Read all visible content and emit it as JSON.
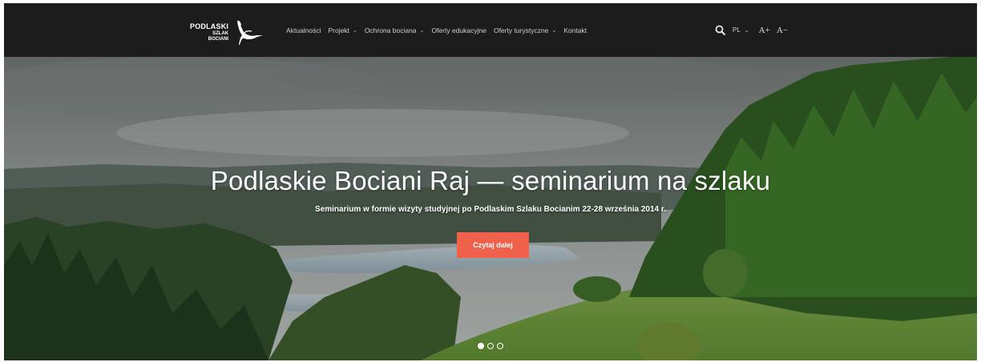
{
  "logo": {
    "line1": "PODLASKI",
    "line2": "SZLAK",
    "line3": "BOCIANI",
    "icon": "stork-icon"
  },
  "nav": {
    "items": [
      {
        "label": "Aktualności",
        "has_dropdown": false
      },
      {
        "label": "Projekt",
        "has_dropdown": true
      },
      {
        "label": "Ochrona bociana",
        "has_dropdown": true
      },
      {
        "label": "Oferty edukacyjne",
        "has_dropdown": false
      },
      {
        "label": "Oferty turystyczne",
        "has_dropdown": true
      },
      {
        "label": "Kontakt",
        "has_dropdown": false
      }
    ],
    "chevron": "⌄"
  },
  "tools": {
    "search_icon": "search-icon",
    "language": "PL",
    "font_increase": "A+",
    "font_decrease": "A−"
  },
  "hero": {
    "title": "Podlaskie Bociani Raj — seminarium na szlaku",
    "subtitle": "Seminarium w formie wizyty studyjnej po Podlaskim Szlaku Bocianim 22-28 września 2014 r.",
    "cta_label": "Czytaj dalej",
    "slides": {
      "total": 3,
      "active": 1
    }
  },
  "colors": {
    "nav_bg": "#1c1c1c",
    "accent": "#f0614c"
  }
}
